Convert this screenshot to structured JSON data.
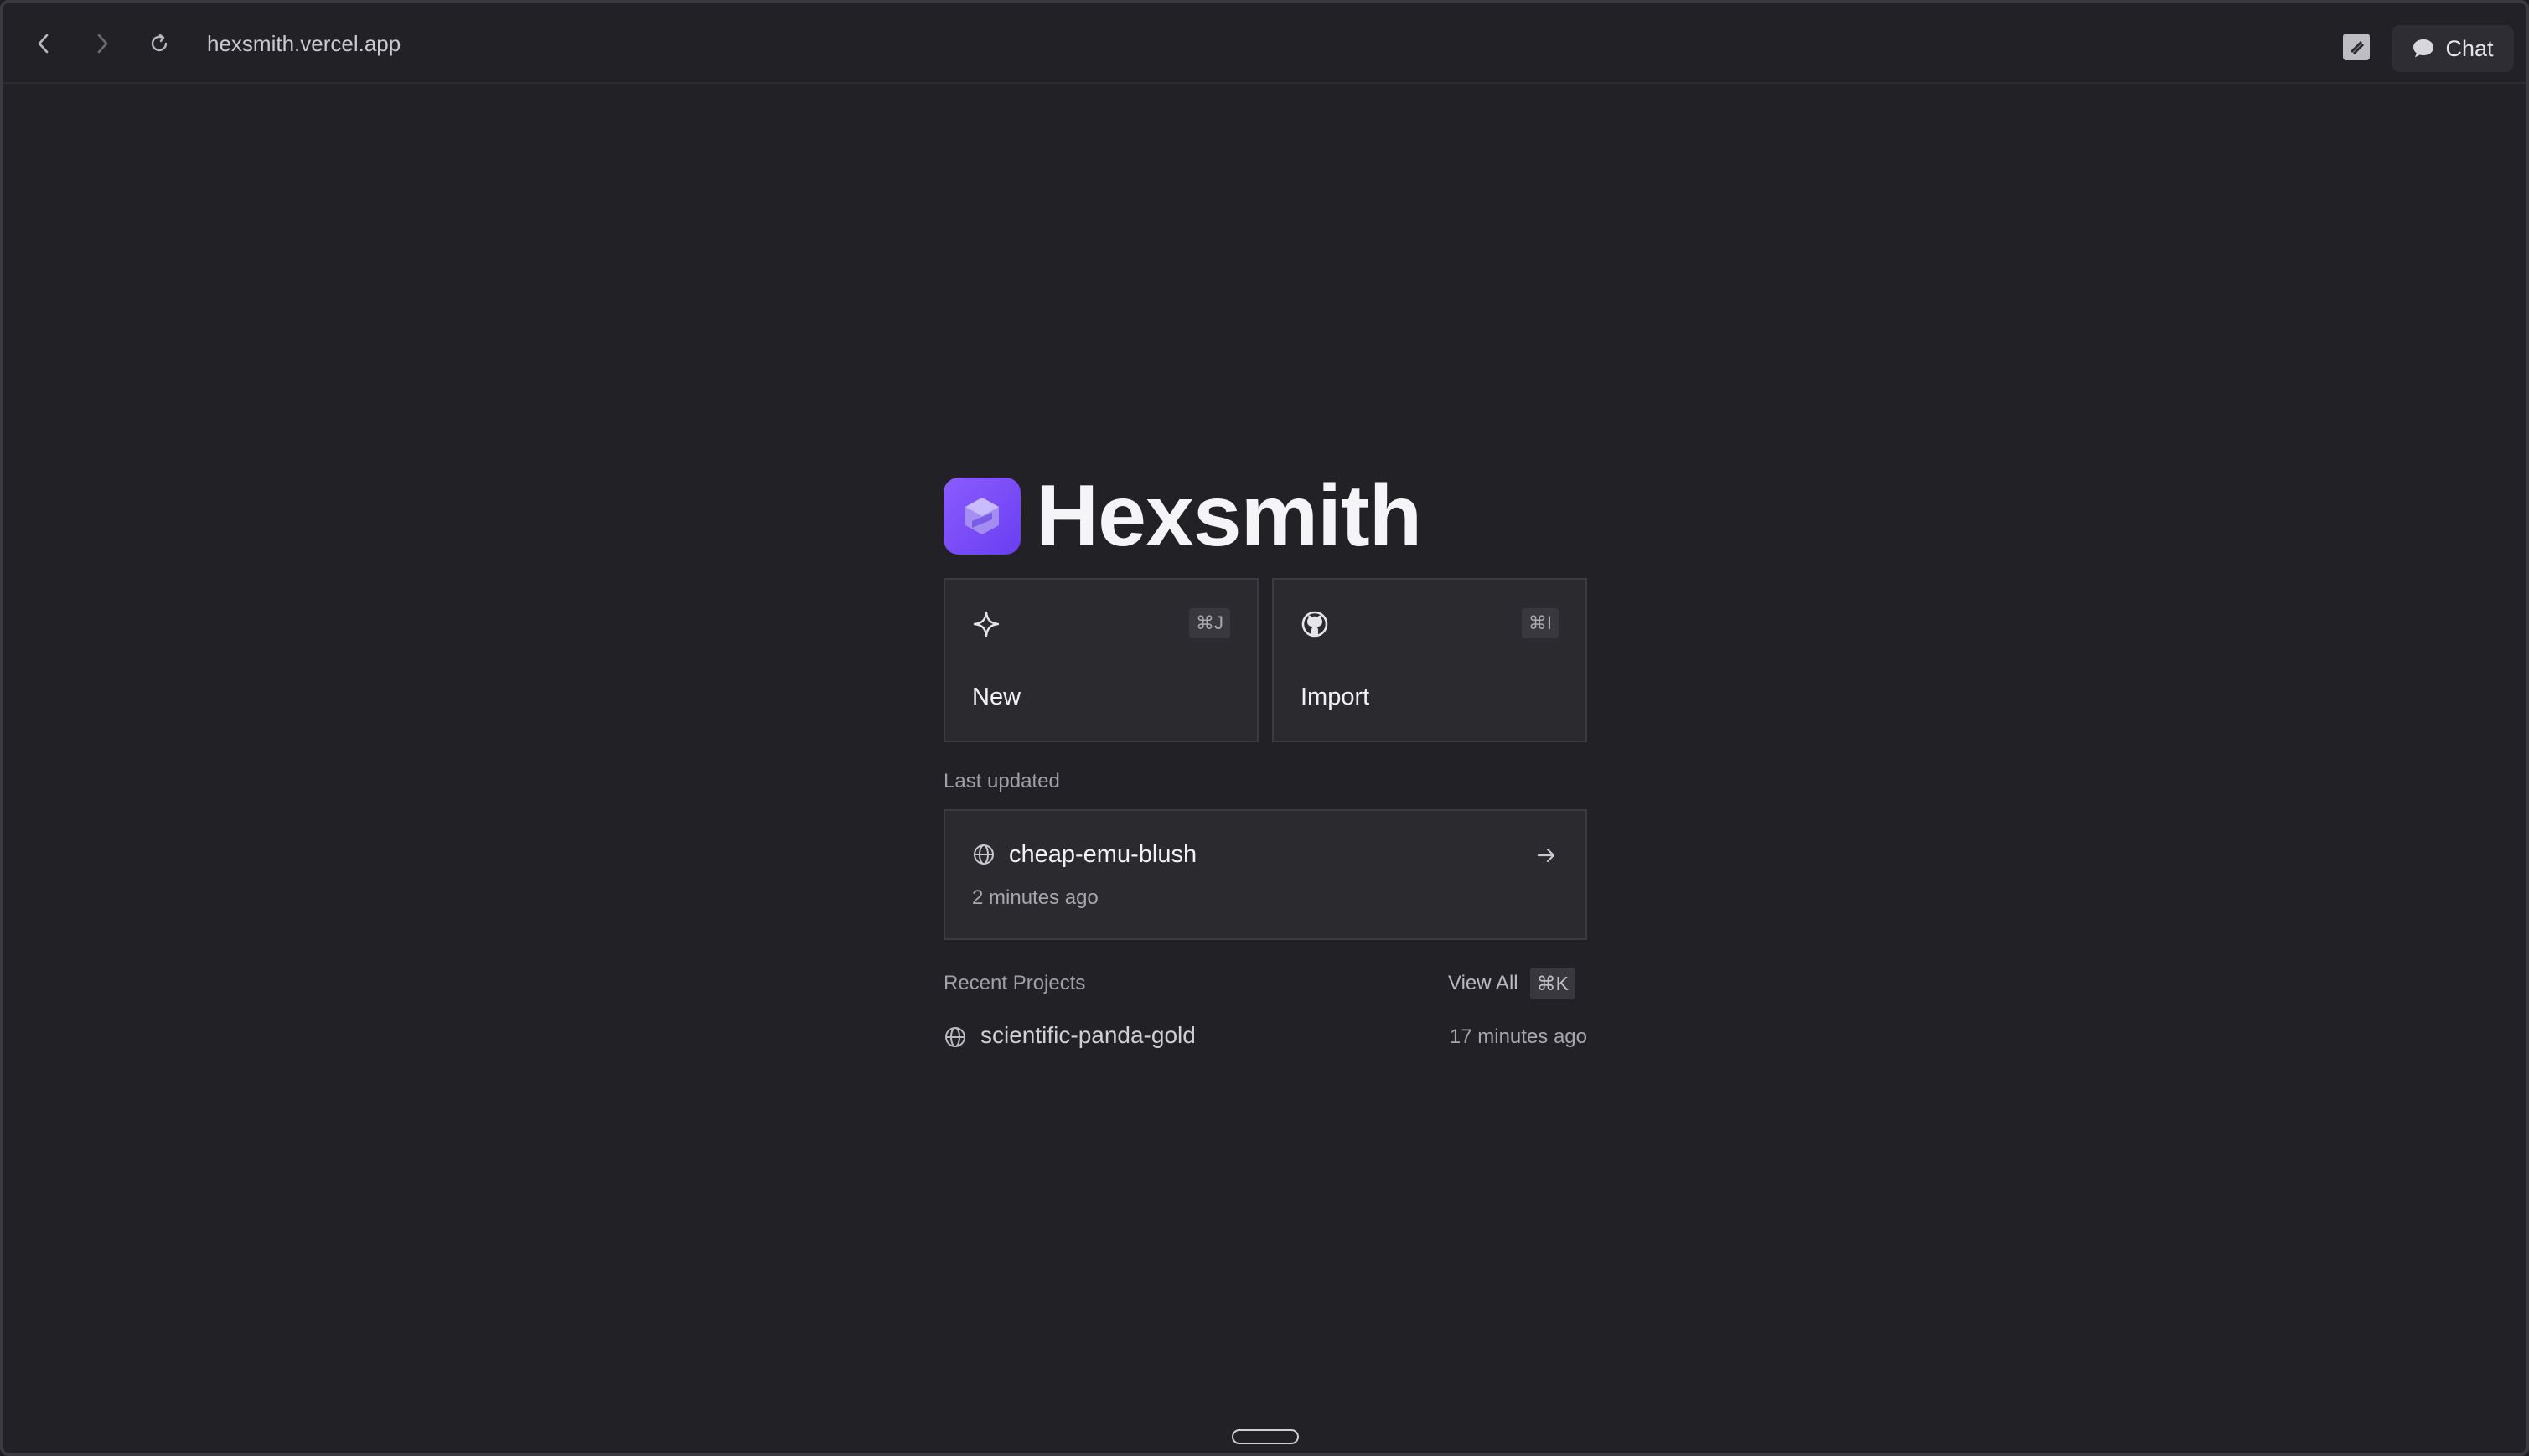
{
  "browser": {
    "url": "hexsmith.vercel.app",
    "chat_label": "Chat",
    "icons": [
      "back-arrow-icon",
      "forward-arrow-icon",
      "reload-icon",
      "extension-icon",
      "chat-bubble-icon"
    ]
  },
  "brand": {
    "title": "Hexsmith",
    "logo_colors": [
      "#8a5cff",
      "#6a3ef0"
    ]
  },
  "actions": [
    {
      "label": "New",
      "shortcut": "⌘J",
      "icon": "sparkle-icon"
    },
    {
      "label": "Import",
      "shortcut": "⌘I",
      "icon": "github-icon"
    }
  ],
  "last_updated": {
    "section_label": "Last updated",
    "project_name": "cheap-emu-blush",
    "time": "2 minutes ago"
  },
  "recent": {
    "section_label": "Recent Projects",
    "view_all_label": "View All",
    "view_all_shortcut": "⌘K",
    "items": [
      {
        "name": "scientific-panda-gold",
        "time": "17 minutes ago"
      }
    ]
  }
}
